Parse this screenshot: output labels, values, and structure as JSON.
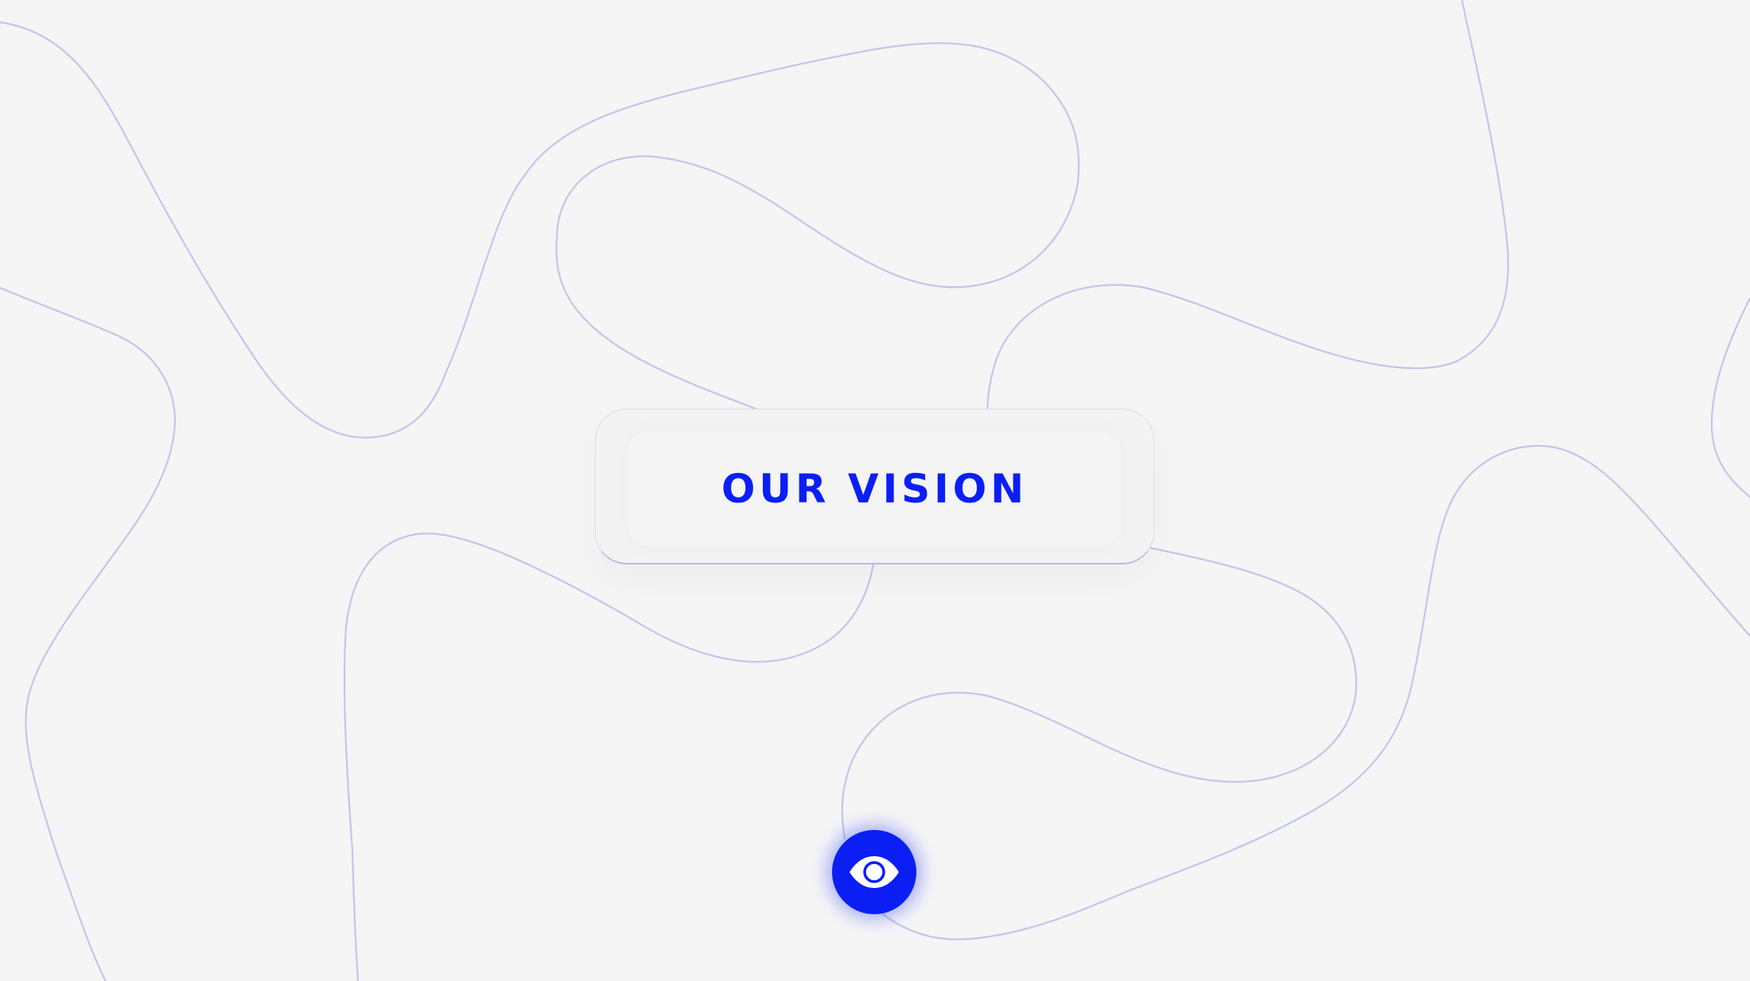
{
  "heading": {
    "title": "OUR VISION"
  },
  "eye_button": {
    "icon": "eye-icon"
  },
  "colors": {
    "accent": "#0b1ff5",
    "background": "#f5f5f6",
    "line": "#c4c6e8"
  }
}
